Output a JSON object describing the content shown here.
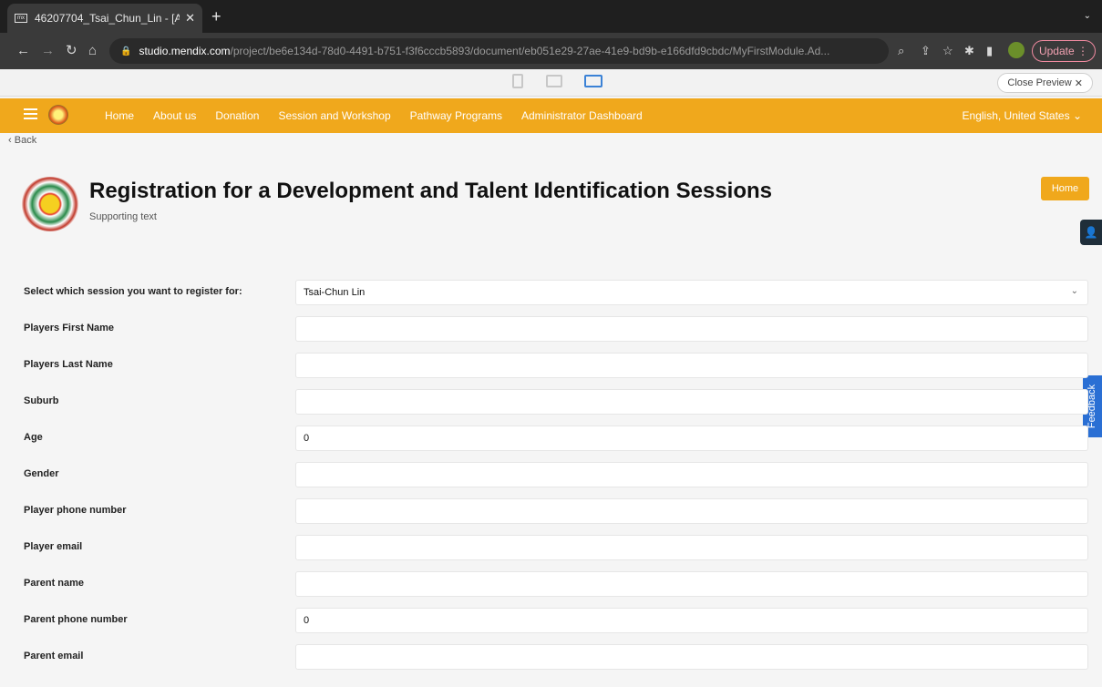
{
  "browser": {
    "tab_title": "46207704_Tsai_Chun_Lin - [A",
    "tab_favicon_text": "mx",
    "url_host": "studio.mendix.com",
    "url_path": "/project/be6e134d-78d0-4491-b751-f3f6cccb5893/document/eb051e29-27ae-41e9-bd9b-e166dfd9cbdc/MyFirstModule.Ad...",
    "update_label": "Update"
  },
  "preview": {
    "close_label": "Close Preview"
  },
  "nav": {
    "links": [
      "Home",
      "About us",
      "Donation",
      "Session and Workshop",
      "Pathway Programs",
      "Administrator Dashboard"
    ],
    "language": "English, United States"
  },
  "page": {
    "back_label": "Back",
    "title": "Registration for a Development and Talent Identification Sessions",
    "subtitle": "Supporting text",
    "home_button": "Home",
    "feedback_label": "Feedback"
  },
  "form": {
    "fields": [
      {
        "label": "Select which session you want to register for:",
        "value": "Tsai-Chun Lin"
      },
      {
        "label": "Players First Name",
        "value": ""
      },
      {
        "label": "Players Last Name",
        "value": ""
      },
      {
        "label": "Suburb",
        "value": ""
      },
      {
        "label": "Age",
        "value": "0"
      },
      {
        "label": "Gender",
        "value": ""
      },
      {
        "label": "Player phone number",
        "value": ""
      },
      {
        "label": "Player email",
        "value": ""
      },
      {
        "label": "Parent name",
        "value": ""
      },
      {
        "label": "Parent phone number",
        "value": "0"
      },
      {
        "label": "Parent email",
        "value": ""
      }
    ]
  },
  "colors": {
    "brand": "#f0a81c",
    "feedback": "#2a6fd4"
  }
}
